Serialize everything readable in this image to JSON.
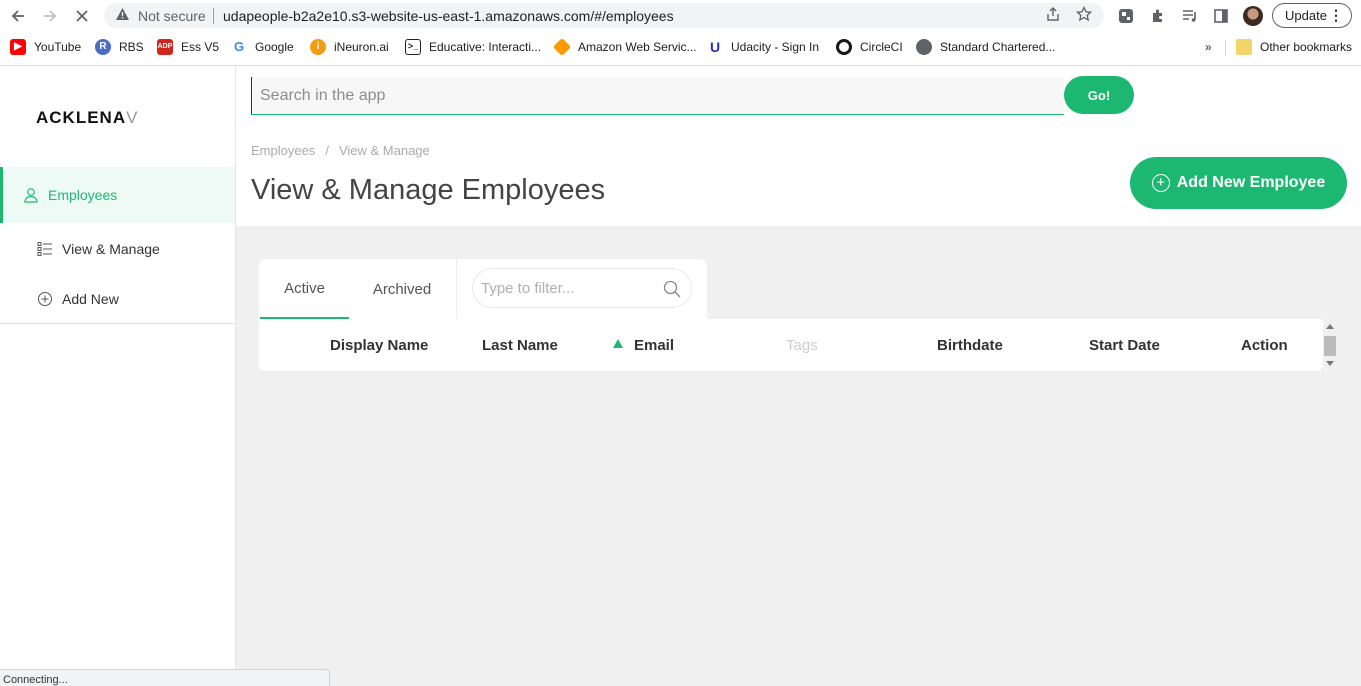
{
  "browser": {
    "security_label": "Not secure",
    "url": "udapeople-b2a2e10.s3-website-us-east-1.amazonaws.com/#/employees",
    "update_label": "Update",
    "status_text": "Connecting...",
    "bookmarks": [
      {
        "label": "YouTube",
        "icon": "youtube-icon",
        "color": "#ff0000"
      },
      {
        "label": "RBS",
        "icon": "lock-icon",
        "color": "#4285f4"
      },
      {
        "label": "Ess V5",
        "icon": "adp-icon",
        "color": "#d0271d"
      },
      {
        "label": "Google",
        "icon": "google-icon",
        "color": "#4285f4"
      },
      {
        "label": "iNeuron.ai",
        "icon": "ineuron-icon",
        "color": "#f39c12"
      },
      {
        "label": "Educative: Interacti...",
        "icon": "educative-icon",
        "color": "#333333"
      },
      {
        "label": "Amazon Web Servic...",
        "icon": "aws-icon",
        "color": "#ff9900"
      },
      {
        "label": "Udacity - Sign In",
        "icon": "udacity-icon",
        "color": "#02b3e4"
      },
      {
        "label": "CircleCI",
        "icon": "circleci-icon",
        "color": "#161616"
      },
      {
        "label": "Standard Chartered...",
        "icon": "globe-icon",
        "color": "#5f6368"
      }
    ],
    "overflow_label": "»",
    "other_bookmarks": "Other bookmarks"
  },
  "app": {
    "logo_main": "ACKLENA",
    "logo_fade": "V",
    "search_placeholder": "Search in the app",
    "go_label": "Go!",
    "sidebar": {
      "items": [
        {
          "label": "Employees",
          "icon": "user-icon",
          "active": true
        },
        {
          "label": "View & Manage",
          "icon": "list-icon",
          "active": false
        },
        {
          "label": "Add New",
          "icon": "plus-circle-icon",
          "active": false
        }
      ]
    },
    "breadcrumb": [
      "Employees",
      "View & Manage"
    ],
    "breadcrumb_sep": "/",
    "page_title": "View & Manage Employees",
    "add_employee_label": "Add New Employee",
    "tabs": [
      {
        "label": "Active",
        "active": true
      },
      {
        "label": "Archived",
        "active": false
      }
    ],
    "filter_placeholder": "Type to filter...",
    "table": {
      "columns": [
        "Display Name",
        "Last Name",
        "Email",
        "Tags",
        "Birthdate",
        "Start Date",
        "Action"
      ]
    },
    "accent_color": "#1cb871"
  }
}
